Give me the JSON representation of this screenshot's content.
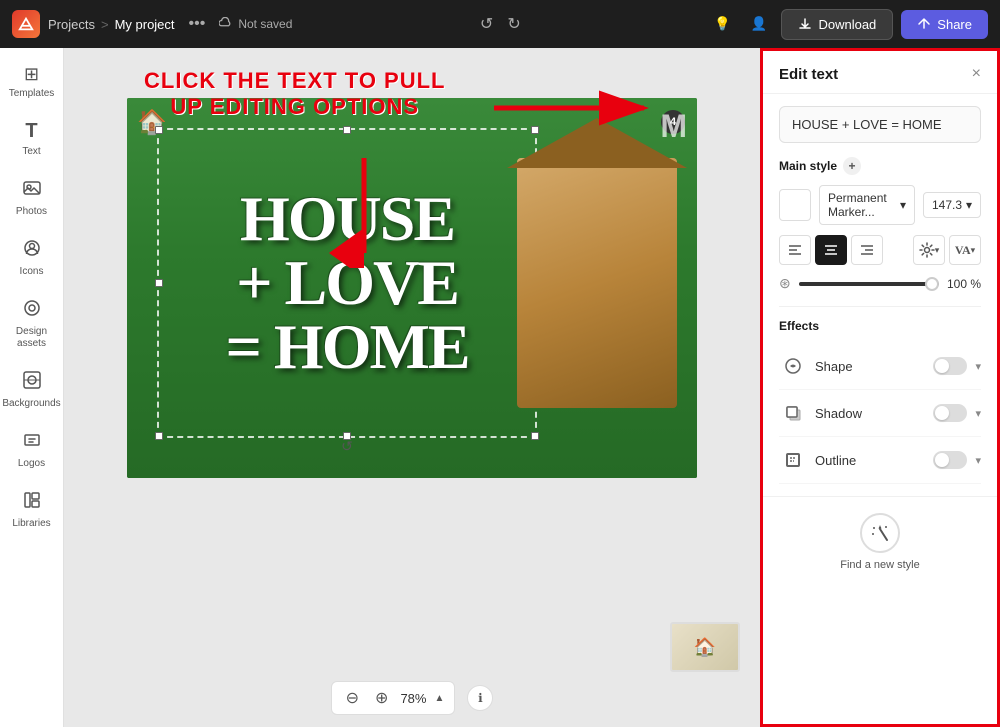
{
  "topbar": {
    "logo_text": "Ai",
    "breadcrumb": {
      "projects": "Projects",
      "separator": ">",
      "current": "My project"
    },
    "more_label": "•••",
    "save_status": "Not saved",
    "undo_label": "↺",
    "redo_label": "↻",
    "download_label": "Download",
    "share_label": "Share"
  },
  "sidebar": {
    "items": [
      {
        "id": "templates",
        "label": "Templates",
        "icon": "⊞"
      },
      {
        "id": "text",
        "label": "Text",
        "icon": "T"
      },
      {
        "id": "photos",
        "label": "Photos",
        "icon": "🖼"
      },
      {
        "id": "icons",
        "label": "Icons",
        "icon": "☺"
      },
      {
        "id": "design-assets",
        "label": "Design assets",
        "icon": "◎"
      },
      {
        "id": "backgrounds",
        "label": "Backgrounds",
        "icon": "⊗"
      },
      {
        "id": "logos",
        "label": "Logos",
        "icon": "📦"
      },
      {
        "id": "libraries",
        "label": "Libraries",
        "icon": "📚"
      }
    ]
  },
  "canvas": {
    "instruction_line1": "CLICK THE TEXT TO PULL",
    "instruction_line2": "UP EDITING OPTIONS",
    "text_content_line1": "HOUSE",
    "text_content_line2": "+ LOVE",
    "text_content_line3": "= HOME",
    "zoom_value": "78%",
    "page_number": "4"
  },
  "panel": {
    "title": "Edit text",
    "close_label": "×",
    "text_value": "HOUSE + LOVE = HOME",
    "main_style_label": "Main style",
    "add_style_label": "+",
    "font_name": "Permanent Marker...",
    "font_size": "147.3",
    "font_size_chevron": "▾",
    "font_name_chevron": "▾",
    "align_left": "≡",
    "align_center": "≡",
    "align_right": "≡",
    "opacity_value": "100 %",
    "effects_title": "Effects",
    "shape_label": "Shape",
    "shadow_label": "Shadow",
    "outline_label": "Outline",
    "find_style_label": "Find a new style"
  }
}
